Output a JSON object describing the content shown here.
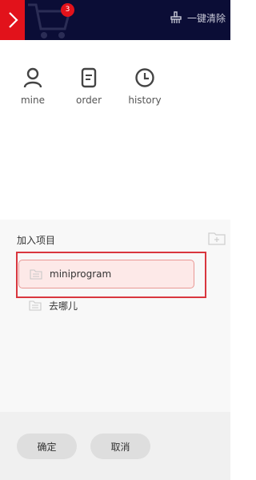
{
  "header": {
    "cart_count": "3",
    "clear_all_label": "一键清除"
  },
  "nav": [
    {
      "label": "mine",
      "icon": "person-icon"
    },
    {
      "label": "order",
      "icon": "document-icon"
    },
    {
      "label": "history",
      "icon": "clock-icon"
    }
  ],
  "project_panel": {
    "title": "加入项目",
    "items": [
      {
        "label": "miniprogram",
        "selected": true
      },
      {
        "label": "去哪儿",
        "selected": false
      }
    ]
  },
  "footer": {
    "confirm_label": "确定",
    "cancel_label": "取消"
  },
  "colors": {
    "header_bg": "#0b0d36",
    "accent_red": "#e2121b",
    "selected_row_bg": "#fde9e8"
  }
}
